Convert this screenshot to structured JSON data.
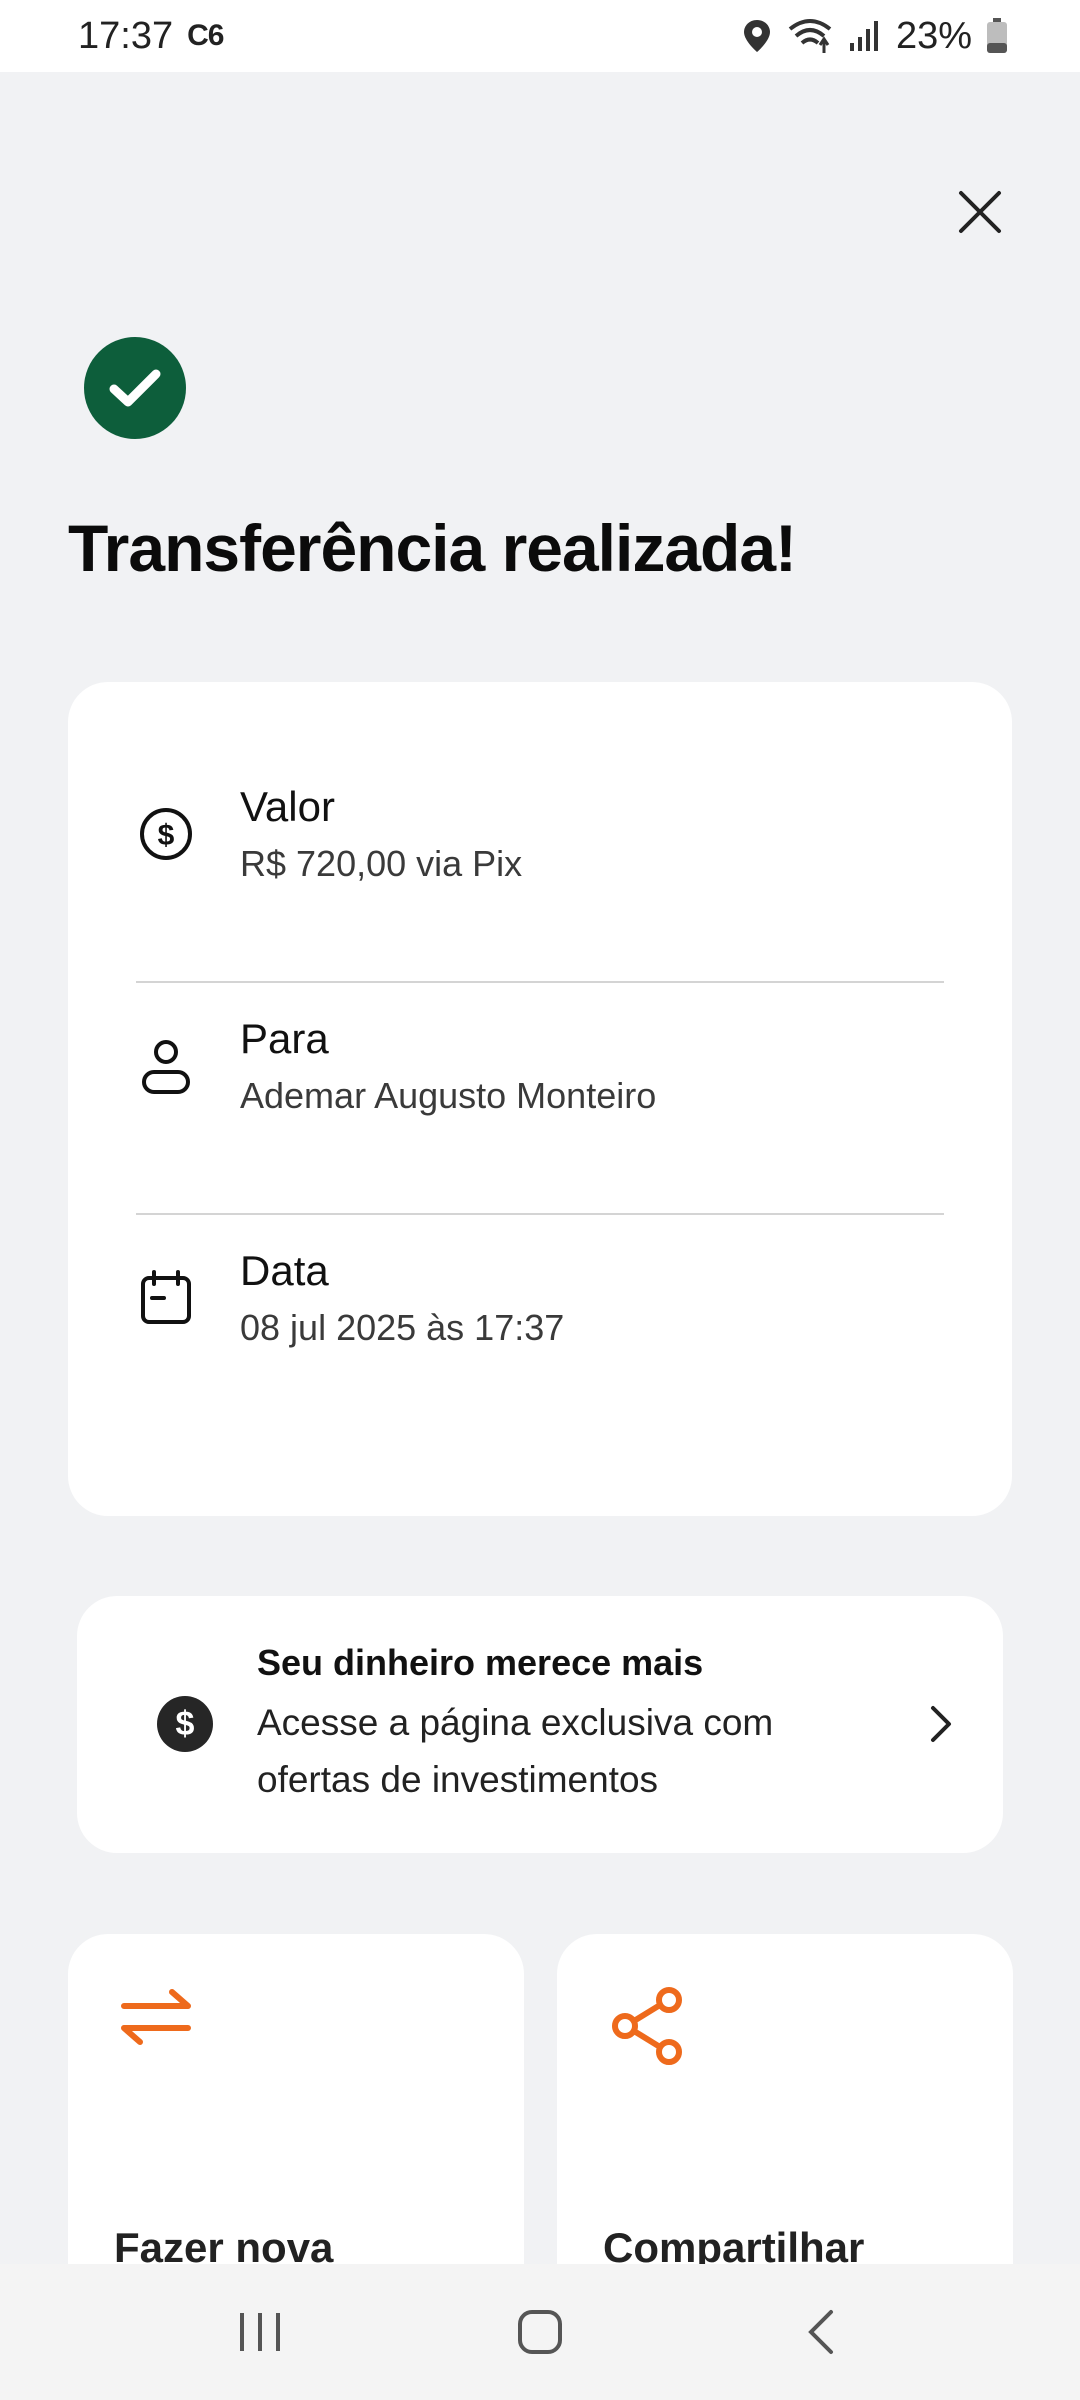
{
  "status_bar": {
    "time": "17:37",
    "carrier_badge": "C6",
    "battery": "23%",
    "icons": [
      "location-icon",
      "wifi-icon",
      "signal-icon",
      "battery-icon"
    ]
  },
  "colors": {
    "success_green": "#0d5e3b",
    "accent_orange": "#ee6a1c",
    "background": "#f1f2f4"
  },
  "header": {
    "title": "Transferência realizada!",
    "success_icon": "check-circle-icon",
    "close_icon": "close-icon"
  },
  "details": [
    {
      "label": "Valor",
      "value": "R$ 720,00 via Pix",
      "icon": "dollar-circle-icon"
    },
    {
      "label": "Para",
      "value": "Ademar Augusto Monteiro",
      "icon": "user-icon"
    },
    {
      "label": "Data",
      "value": "08 jul 2025 às 17:37",
      "icon": "calendar-icon"
    }
  ],
  "promo": {
    "title": "Seu dinheiro merece mais",
    "description": "Acesse a página exclusiva com ofertas de investimentos",
    "icon_symbol": "$",
    "icon": "dollar-badge-icon"
  },
  "actions": [
    {
      "label": "Fazer nova",
      "icon": "transfer-arrows-icon"
    },
    {
      "label": "Compartilhar",
      "icon": "share-icon"
    }
  ],
  "nav": [
    "recent-apps-icon",
    "home-icon",
    "back-icon"
  ]
}
